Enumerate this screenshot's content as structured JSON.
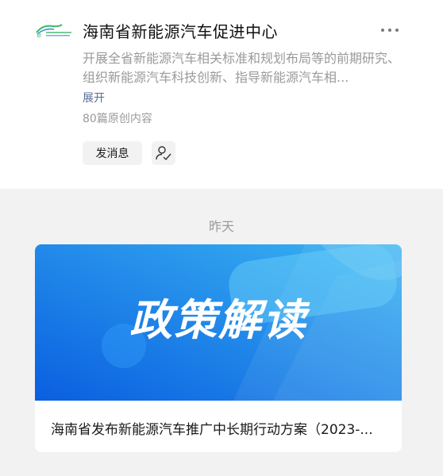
{
  "account": {
    "name": "海南省新能源汽车促进中心",
    "description": "开展全省新能源汽车相关标准和规划布局等的前期研究、组织新能源汽车科技创新、指导新能源汽车相...",
    "expand_label": "展开",
    "article_count": "80篇原创内容",
    "message_button": "发消息",
    "logo_icon": "org-logo-icon",
    "colors": {
      "accent": "#576b95",
      "logo_green": "#3fb56a",
      "logo_blue": "#2a8fd6"
    }
  },
  "feed": {
    "date_label": "昨天",
    "articles": [
      {
        "cover_text": "政策解读",
        "title": "海南省发布新能源汽车推广中长期行动方案（2023-...",
        "cover_colors": {
          "start": "#0a5fe0",
          "end": "#3ab4f2"
        }
      }
    ]
  }
}
